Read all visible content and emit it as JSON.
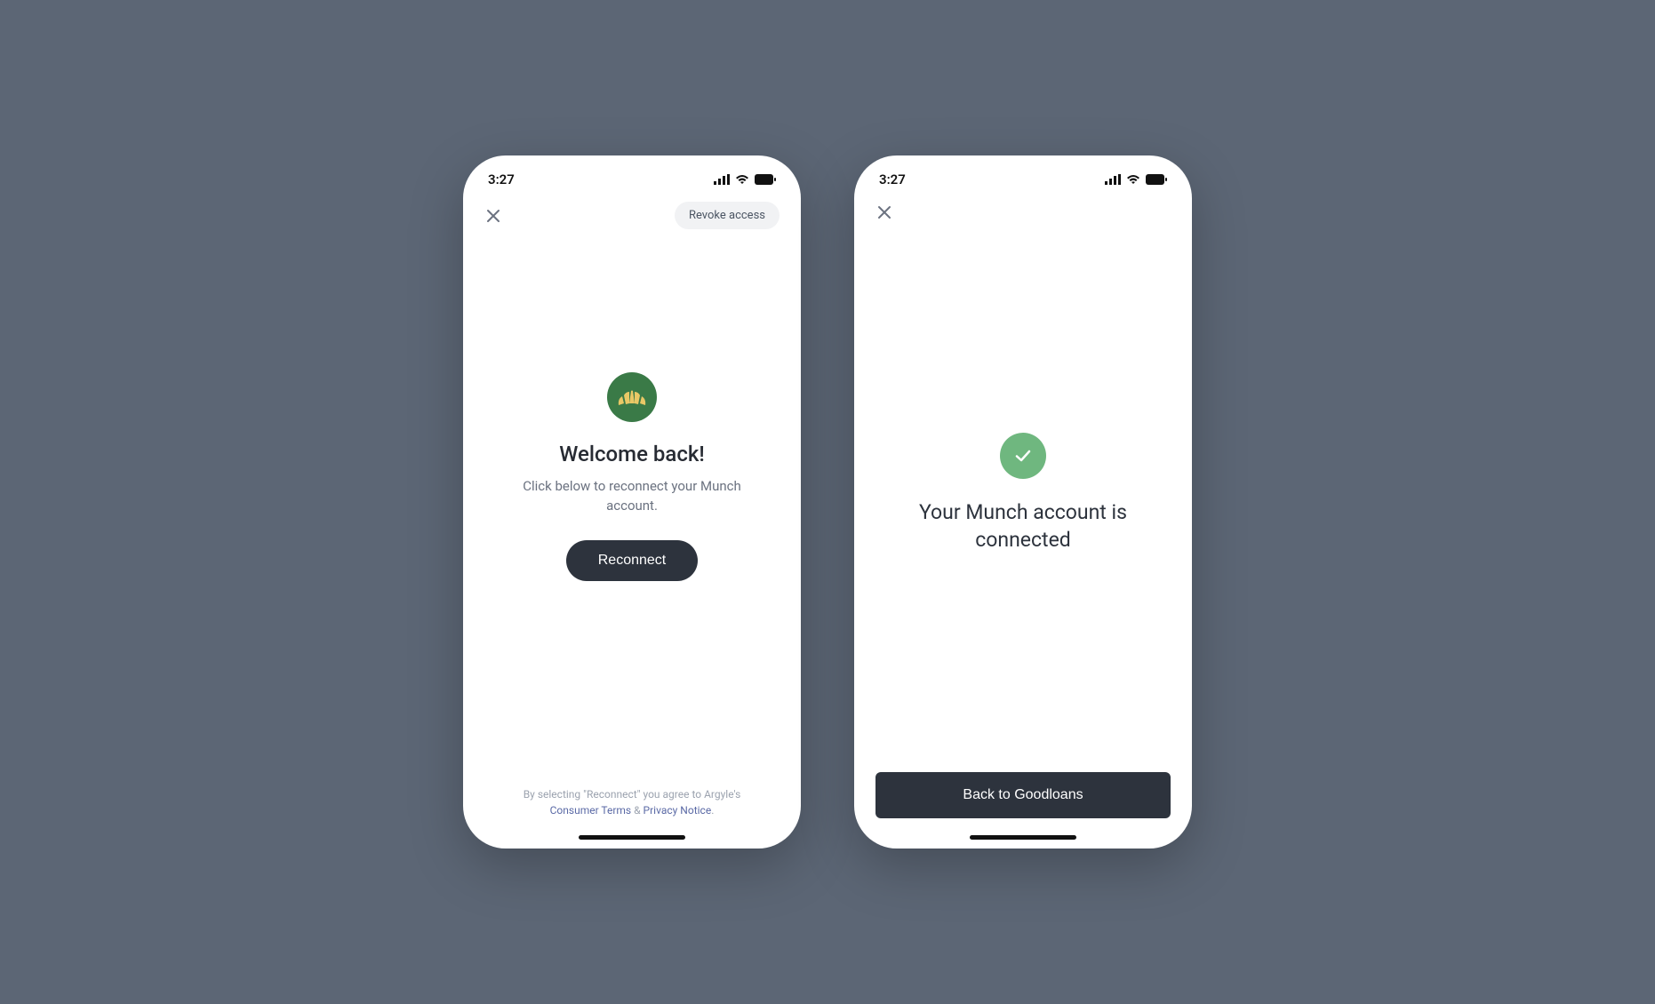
{
  "status": {
    "time": "3:27"
  },
  "screen1": {
    "revoke_label": "Revoke access",
    "title": "Welcome back!",
    "subtitle": "Click below to reconnect your Munch account.",
    "cta": "Reconnect",
    "legal_prefix": "By selecting \"Reconnect\" you agree to Argyle's",
    "legal_link1": "Consumer Terms",
    "legal_amp": " & ",
    "legal_link2": "Privacy Notice",
    "legal_period": "."
  },
  "screen2": {
    "success": "Your Munch account is connected",
    "cta": "Back to Goodloans"
  }
}
